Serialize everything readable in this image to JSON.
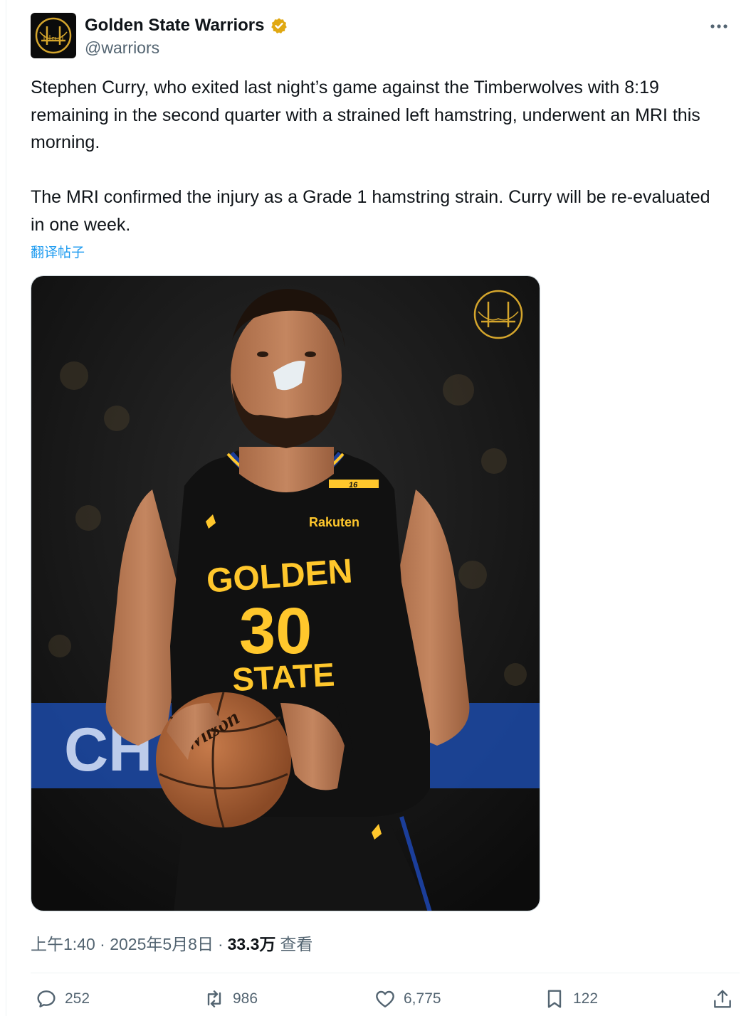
{
  "tweet": {
    "author": {
      "display_name": "Golden State Warriors",
      "handle": "@warriors",
      "verified_badge_color": "#e0a812"
    },
    "paragraphs": [
      "Stephen Curry, who exited last night’s game against the Timberwolves with 8:19 remaining in the second quarter with a strained left hamstring, underwent an MRI this morning.",
      "The MRI confirmed the injury as a Grade 1 hamstring strain. Curry will be re-evaluated in one week."
    ],
    "translate_label": "翻译帖子",
    "media": {
      "jersey_wordmark_top": "GOLDEN",
      "jersey_number": "30",
      "jersey_wordmark_bottom": "STATE",
      "patch_text": "Rakuten",
      "shoulder_number": "16",
      "ball_brand": "Wilson",
      "background_sign": "CH"
    },
    "timestamp": "上午1:40 · 2025年5月8日",
    "separator": "·",
    "views_count": "33.3万",
    "views_label": "查看",
    "actions": {
      "replies": "252",
      "retweets": "986",
      "likes": "6,775",
      "bookmarks": "122"
    }
  },
  "colors": {
    "brand_gold": "#ffc72c",
    "link_blue": "#1d9bf0",
    "secondary_text": "#536471"
  }
}
